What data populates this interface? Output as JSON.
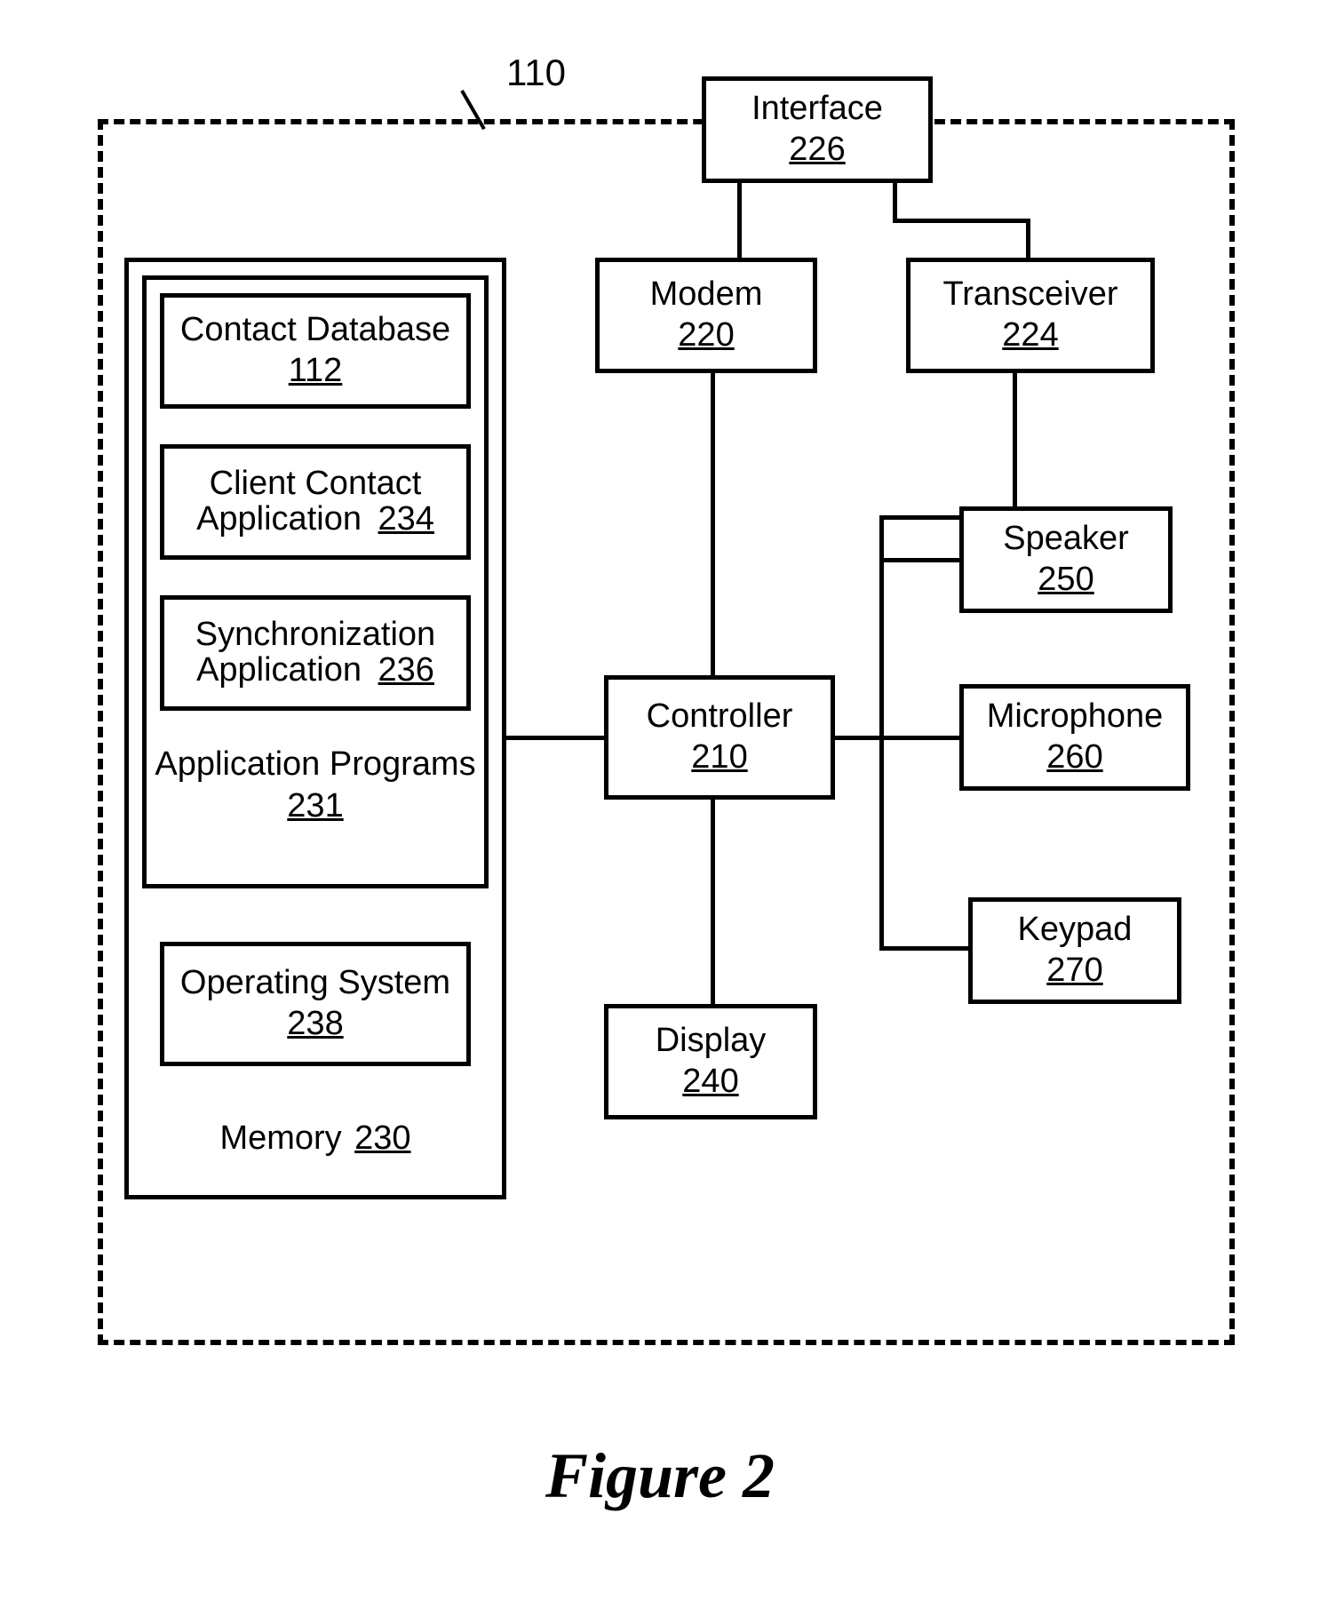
{
  "reference_label": "110",
  "figure_caption": "Figure 2",
  "blocks": {
    "interface": {
      "label": "Interface",
      "ref": "226"
    },
    "modem": {
      "label": "Modem",
      "ref": "220"
    },
    "transceiver": {
      "label": "Transceiver",
      "ref": "224"
    },
    "controller": {
      "label": "Controller",
      "ref": "210"
    },
    "speaker": {
      "label": "Speaker",
      "ref": "250"
    },
    "microphone": {
      "label": "Microphone",
      "ref": "260"
    },
    "keypad": {
      "label": "Keypad",
      "ref": "270"
    },
    "display": {
      "label": "Display",
      "ref": "240"
    },
    "memory": {
      "label": "Memory",
      "ref": "230"
    },
    "app_programs": {
      "label": "Application Programs",
      "ref": "231"
    },
    "contact_db": {
      "label": "Contact Database",
      "ref": "112"
    },
    "client_contact": {
      "label": "Client Contact Application",
      "ref": "234"
    },
    "sync_app": {
      "label": "Synchronization Application",
      "ref": "236"
    },
    "os": {
      "label": "Operating System",
      "ref": "238"
    }
  }
}
